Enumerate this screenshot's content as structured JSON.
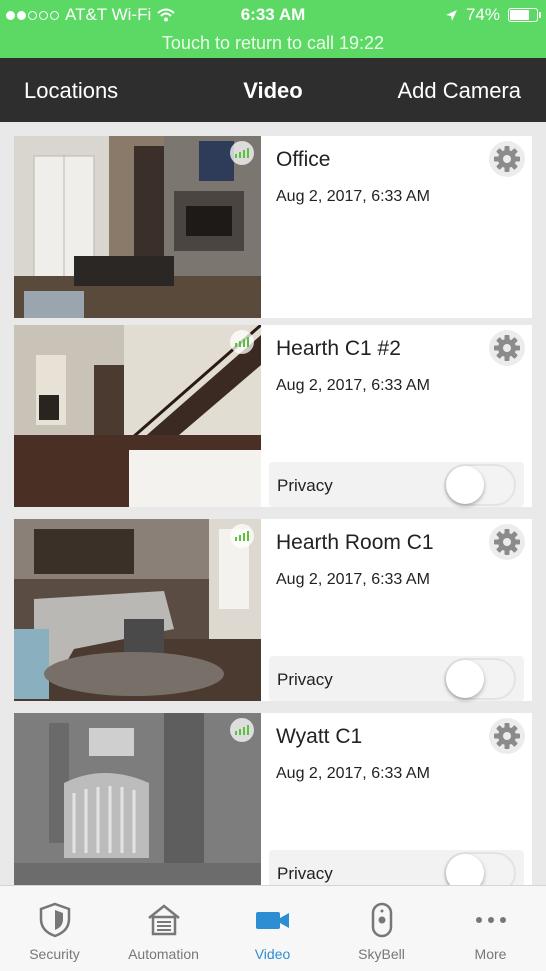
{
  "status_bar": {
    "carrier": "AT&T Wi-Fi",
    "time": "6:33 AM",
    "battery": "74%",
    "battery_level": 0.74,
    "signal_bars": 2,
    "signal_total": 5
  },
  "call_banner": "Touch to return to call 19:22",
  "nav": {
    "left": "Locations",
    "title": "Video",
    "right": "Add Camera"
  },
  "cameras": [
    {
      "name": "Office",
      "date": "Aug 2, 2017, 6:33 AM",
      "privacy_label": "",
      "privacy_on": false
    },
    {
      "name": "Hearth C1 #2",
      "date": "Aug 2, 2017, 6:33 AM",
      "privacy_label": "Privacy",
      "privacy_on": false
    },
    {
      "name": "Hearth Room C1",
      "date": "Aug 2, 2017, 6:33 AM",
      "privacy_label": "Privacy",
      "privacy_on": false
    },
    {
      "name": "Wyatt C1",
      "date": "Aug 2, 2017, 6:33 AM",
      "privacy_label": "Privacy",
      "privacy_on": false
    }
  ],
  "tabs": [
    {
      "label": "Security",
      "icon": "shield-icon"
    },
    {
      "label": "Automation",
      "icon": "house-icon"
    },
    {
      "label": "Video",
      "icon": "video-camera-icon",
      "active": true
    },
    {
      "label": "SkyBell",
      "icon": "doorbell-icon"
    },
    {
      "label": "More",
      "icon": "more-dots-icon"
    }
  ],
  "colors": {
    "status_green": "#5cd965",
    "nav_dark": "#2e2e2e",
    "active_tab": "#2d8ed4",
    "signal_green": "#5cc13f"
  }
}
